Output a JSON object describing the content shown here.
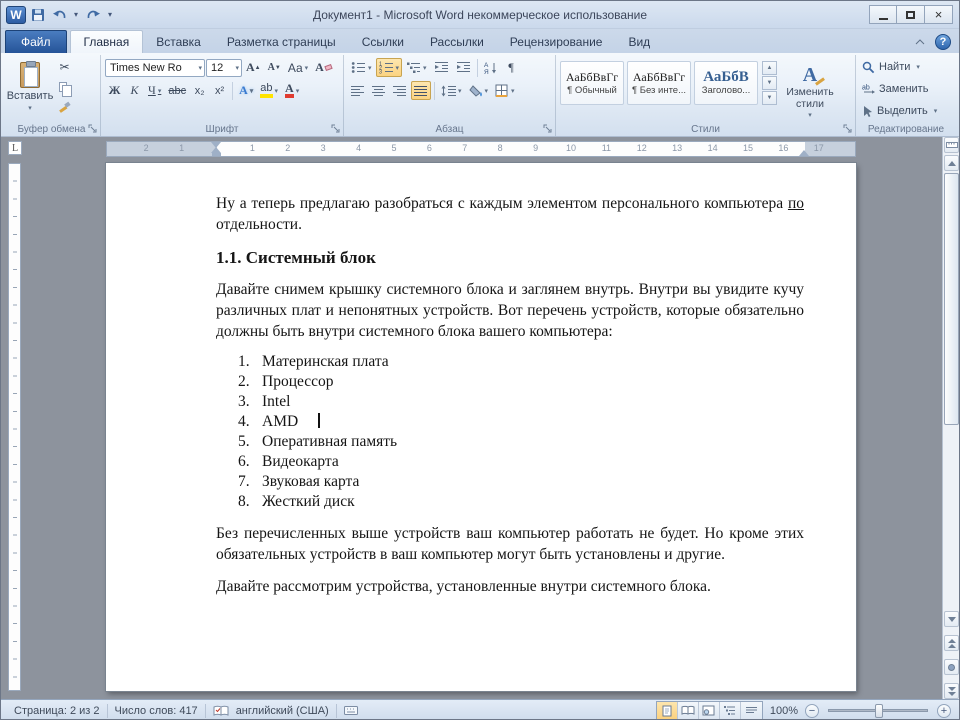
{
  "colors": {
    "selection_orange": "#fbd381",
    "file_tab_blue": "#2c5c9e",
    "heading_blue": "#365f91"
  },
  "titlebar": {
    "title": "Документ1 - Microsoft Word некоммерческое использование"
  },
  "tabs": [
    {
      "label": "Файл"
    },
    {
      "label": "Главная"
    },
    {
      "label": "Вставка"
    },
    {
      "label": "Разметка страницы"
    },
    {
      "label": "Ссылки"
    },
    {
      "label": "Рассылки"
    },
    {
      "label": "Рецензирование"
    },
    {
      "label": "Вид"
    }
  ],
  "ribbon": {
    "clipboard": {
      "group_label": "Буфер обмена",
      "paste_label": "Вставить"
    },
    "font": {
      "group_label": "Шрифт",
      "family": "Times New Ro",
      "size": "12",
      "grow": "А",
      "shrink": "А",
      "change_case": "Аа",
      "clear": "А",
      "bold": "Ж",
      "italic": "К",
      "underline": "Ч",
      "strike": "abc",
      "subscript": "x₂",
      "superscript": "x²",
      "effects": "А",
      "highlight": "ab",
      "font_color": "А"
    },
    "paragraph": {
      "group_label": "Абзац",
      "pilcrow": "¶"
    },
    "styles": {
      "group_label": "Стили",
      "items": [
        {
          "preview": "АаБбВвГг",
          "name": "¶ Обычный"
        },
        {
          "preview": "АаБбВвГг",
          "name": "¶ Без инте..."
        },
        {
          "preview": "АаБбВ",
          "name": "Заголово..."
        }
      ],
      "change_styles_label": "Изменить стили"
    },
    "editing": {
      "group_label": "Редактирование",
      "find": "Найти",
      "replace": "Заменить",
      "select": "Выделить"
    }
  },
  "ruler": {
    "left_numbers": [
      "2",
      "1"
    ],
    "numbers": [
      "1",
      "2",
      "3",
      "4",
      "5",
      "6",
      "7",
      "8",
      "9",
      "10",
      "11",
      "12",
      "13",
      "14",
      "15",
      "16",
      "17"
    ]
  },
  "document": {
    "p1": {
      "l1a": "Ну а теперь предлагаю разобраться с каждым элементом персонального компьютера",
      "l1b": "по",
      "l2": "отдельности."
    },
    "heading": "1.1. Системный блок",
    "p2": {
      "l1": "Давайте снимем крышку системного блока и заглянем внутрь. Внутри вы увидите кучу",
      "l2": "различных плат и непонятных устройств. Вот перечень устройств, которые обязательно",
      "l3": "должны быть внутри системного блока вашего компьютера:"
    },
    "list": [
      {
        "n": "1.",
        "text": "Материнская плата"
      },
      {
        "n": "2.",
        "text": "Процессор"
      },
      {
        "n": "3.",
        "text": "Intel"
      },
      {
        "n": "4.",
        "text": "AMD"
      },
      {
        "n": "5.",
        "text": "Оперативная память"
      },
      {
        "n": "6.",
        "text": "Видеокарта"
      },
      {
        "n": "7.",
        "text": "Звуковая карта"
      },
      {
        "n": "8.",
        "text": "Жесткий диск"
      }
    ],
    "p3": {
      "l1": "Без перечисленных выше устройств ваш компьютер работать не будет. Но кроме этих",
      "l2": "обязательных устройств в ваш компьютер могут быть установлены и другие."
    },
    "p4": "Давайте рассмотрим устройства, установленные внутри системного блока."
  },
  "statusbar": {
    "page": "Страница: 2 из 2",
    "words": "Число слов: 417",
    "language": "английский (США)",
    "zoom": "100%"
  }
}
